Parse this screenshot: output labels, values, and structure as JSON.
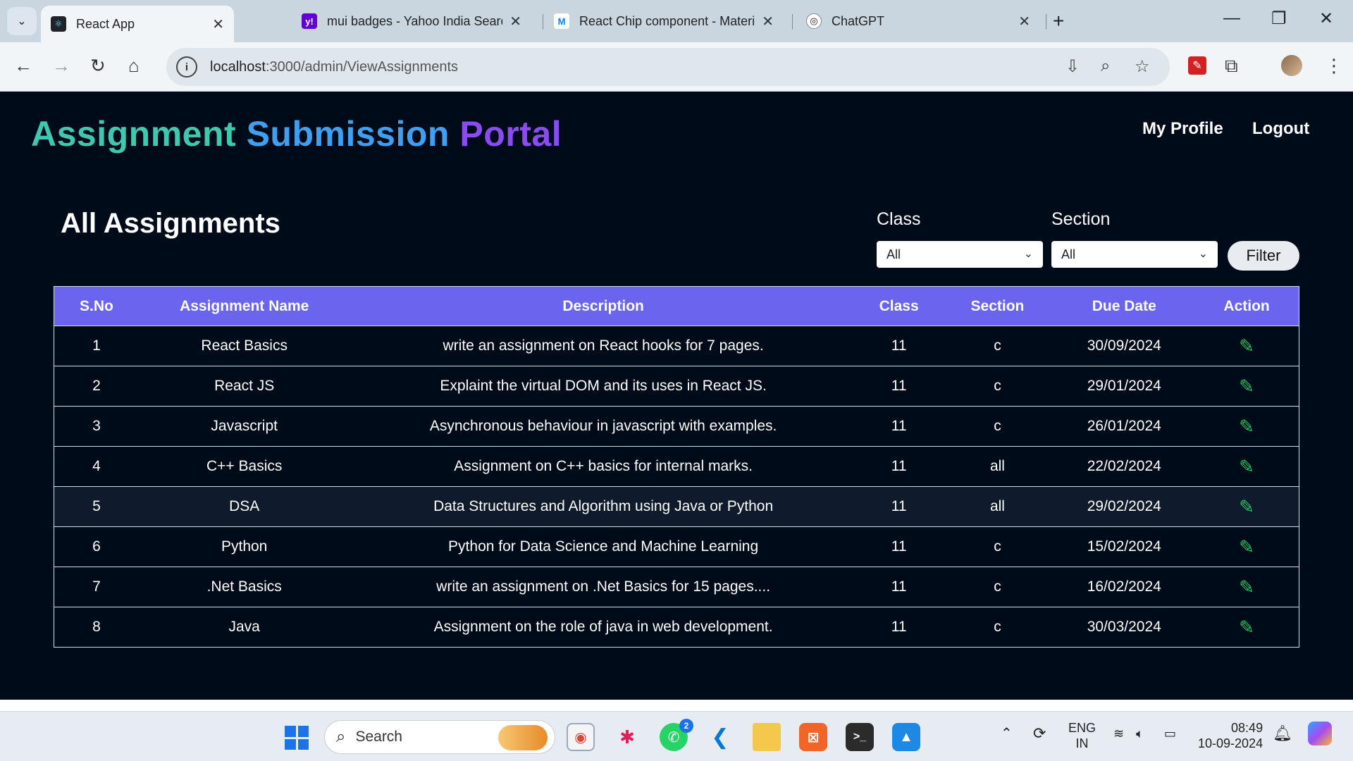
{
  "browser": {
    "tabs": [
      {
        "title": "React App",
        "favicon": "react-icon",
        "active": true
      },
      {
        "title": "mui badges - Yahoo India Searc",
        "favicon": "yahoo-icon",
        "active": false
      },
      {
        "title": "React Chip component - Materi",
        "favicon": "mui-icon",
        "active": false
      },
      {
        "title": "ChatGPT",
        "favicon": "chatgpt-icon",
        "active": false
      }
    ],
    "url_host": "localhost",
    "url_path": ":3000/admin/ViewAssignments"
  },
  "header": {
    "brand_word1": "Assignment",
    "brand_word2": "Submission",
    "brand_word3": "Portal",
    "nav_profile": "My Profile",
    "nav_logout": "Logout"
  },
  "main": {
    "heading": "All Assignments",
    "class_label": "Class",
    "class_value": "All",
    "section_label": "Section",
    "section_value": "All",
    "filter_label": "Filter"
  },
  "table": {
    "headers": [
      "S.No",
      "Assignment Name",
      "Description",
      "Class",
      "Section",
      "Due Date",
      "Action"
    ],
    "rows": [
      {
        "sno": "1",
        "name": "React Basics",
        "desc": "write an assignment on React hooks for 7 pages.",
        "class": "11",
        "section": "c",
        "due": "30/09/2024"
      },
      {
        "sno": "2",
        "name": "React JS",
        "desc": "Explaint the virtual DOM and its uses in React JS.",
        "class": "11",
        "section": "c",
        "due": "29/01/2024"
      },
      {
        "sno": "3",
        "name": "Javascript",
        "desc": "Asynchronous behaviour in javascript with examples.",
        "class": "11",
        "section": "c",
        "due": "26/01/2024"
      },
      {
        "sno": "4",
        "name": "C++ Basics",
        "desc": "Assignment on C++ basics for internal marks.",
        "class": "11",
        "section": "all",
        "due": "22/02/2024"
      },
      {
        "sno": "5",
        "name": "DSA",
        "desc": "Data Structures and Algorithm using Java or Python",
        "class": "11",
        "section": "all",
        "due": "29/02/2024"
      },
      {
        "sno": "6",
        "name": "Python",
        "desc": "Python for Data Science and Machine Learning",
        "class": "11",
        "section": "c",
        "due": "15/02/2024"
      },
      {
        "sno": "7",
        "name": ".Net Basics",
        "desc": "write an assignment on .Net Basics for 15 pages....",
        "class": "11",
        "section": "c",
        "due": "16/02/2024"
      },
      {
        "sno": "8",
        "name": "Java",
        "desc": "Assignment on the role of java in web development.",
        "class": "11",
        "section": "c",
        "due": "30/03/2024"
      }
    ]
  },
  "taskbar": {
    "search_placeholder": "Search",
    "whatsapp_badge": "2",
    "lang_line1": "ENG",
    "lang_line2": "IN",
    "time": "08:49",
    "date": "10-09-2024"
  },
  "colors": {
    "page_bg": "#000b1a",
    "table_header": "#6a64ee",
    "brand_1": "#3fc7b0",
    "brand_2": "#3f9ff0",
    "brand_3": "#8a4cf2",
    "edit_icon": "#22c55e"
  }
}
